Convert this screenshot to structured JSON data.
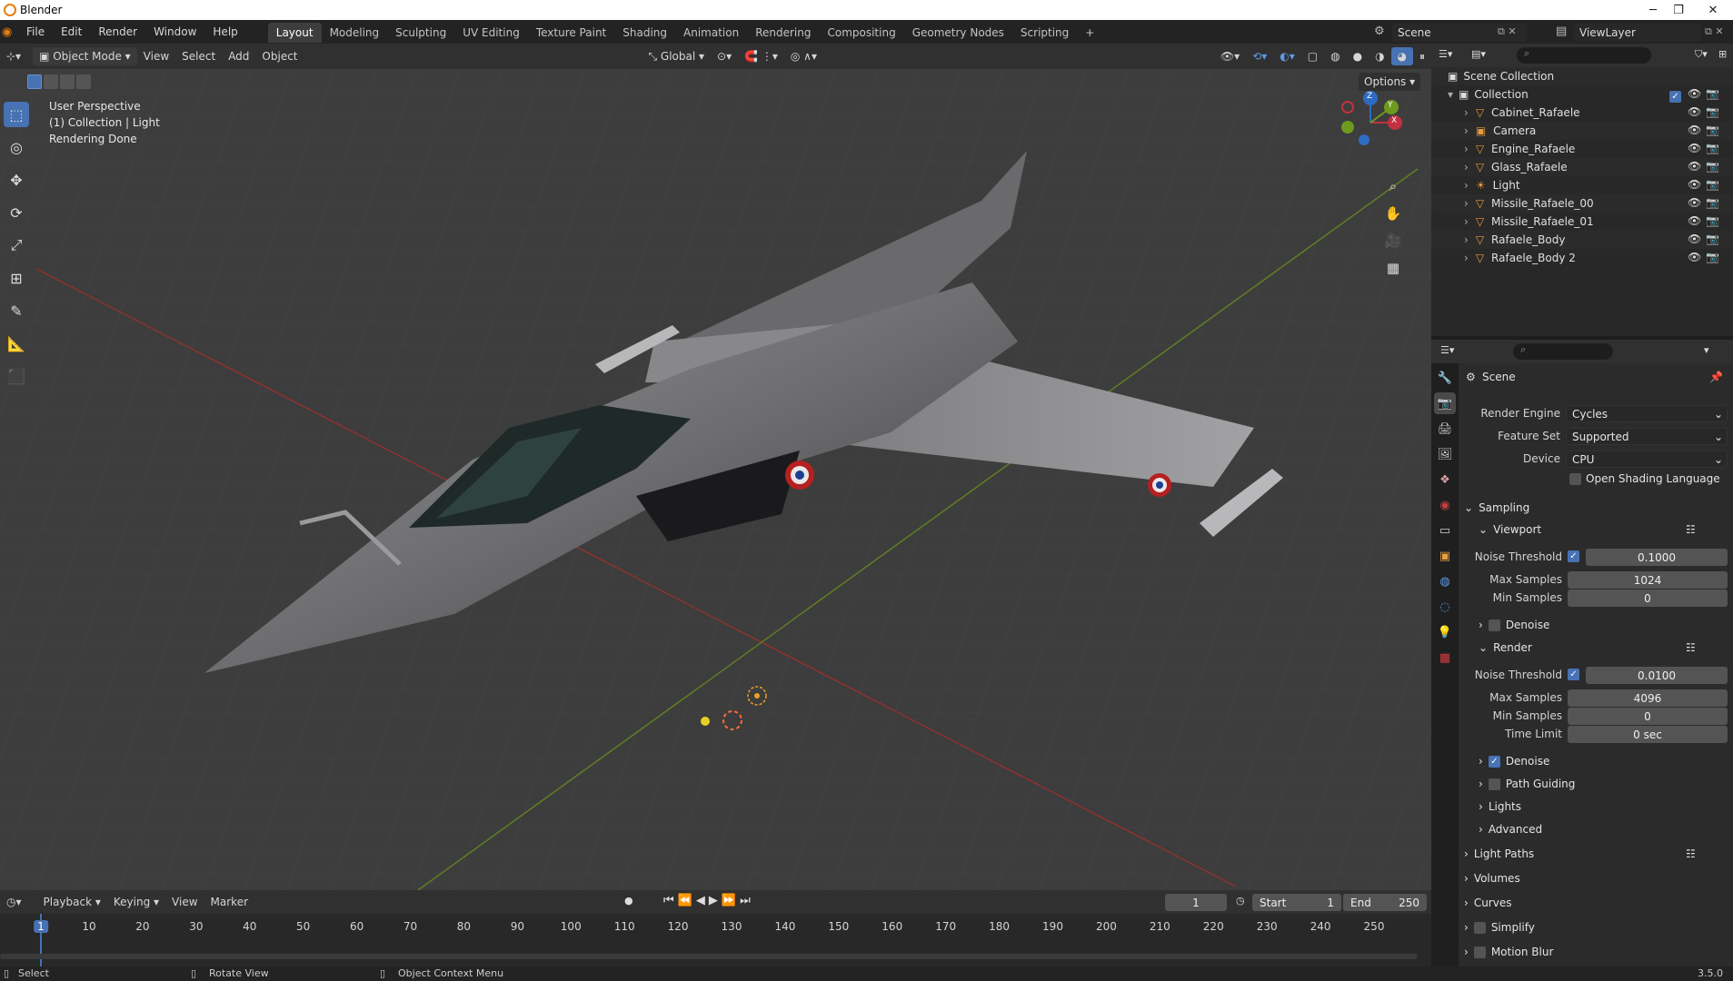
{
  "app": {
    "title": "Blender",
    "minimize": "─",
    "maximize": "❐",
    "close": "✕"
  },
  "menus": [
    "File",
    "Edit",
    "Render",
    "Window",
    "Help"
  ],
  "workspaces": [
    "Layout",
    "Modeling",
    "Sculpting",
    "UV Editing",
    "Texture Paint",
    "Shading",
    "Animation",
    "Rendering",
    "Compositing",
    "Geometry Nodes",
    "Scripting",
    "+"
  ],
  "scene": "Scene",
  "viewlayer": "ViewLayer",
  "viewport": {
    "mode": "Object Mode",
    "menus": [
      "View",
      "Select",
      "Add",
      "Object"
    ],
    "orientation": "Global",
    "options": "Options",
    "info": [
      "User Perspective",
      "(1) Collection | Light",
      "Rendering Done"
    ],
    "gizmo": {
      "x": "X",
      "y": "Y",
      "z": "Z"
    }
  },
  "outliner": {
    "root": "Scene Collection",
    "collection": "Collection",
    "items": [
      {
        "name": "Cabinet_Rafaele",
        "type": "mesh"
      },
      {
        "name": "Camera",
        "type": "camera"
      },
      {
        "name": "Engine_Rafaele",
        "type": "mesh"
      },
      {
        "name": "Glass_Rafaele",
        "type": "mesh"
      },
      {
        "name": "Light",
        "type": "light"
      },
      {
        "name": "Missile_Rafaele_00",
        "type": "mesh"
      },
      {
        "name": "Missile_Rafaele_01",
        "type": "mesh"
      },
      {
        "name": "Rafaele_Body",
        "type": "mesh"
      },
      {
        "name": "Rafaele_Body 2",
        "type": "mesh"
      }
    ]
  },
  "properties": {
    "context": "Scene",
    "render_engine_label": "Render Engine",
    "render_engine": "Cycles",
    "feature_set_label": "Feature Set",
    "feature_set": "Supported",
    "device_label": "Device",
    "device": "CPU",
    "osl_label": "Open Shading Language",
    "sampling": "Sampling",
    "viewport_panel": "Viewport",
    "noise_threshold_label": "Noise Threshold",
    "max_samples_label": "Max Samples",
    "min_samples_label": "Min Samples",
    "vp_noise": "0.1000",
    "vp_max": "1024",
    "vp_min": "0",
    "denoise_label": "Denoise",
    "render_panel": "Render",
    "r_noise": "0.0100",
    "r_max": "4096",
    "r_min": "0",
    "time_limit_label": "Time Limit",
    "r_time": "0 sec",
    "path_guiding": "Path Guiding",
    "lights": "Lights",
    "advanced": "Advanced",
    "light_paths": "Light Paths",
    "volumes": "Volumes",
    "curves": "Curves",
    "simplify": "Simplify",
    "motion_blur": "Motion Blur"
  },
  "timeline": {
    "menus": [
      "Playback",
      "Keying",
      "View",
      "Marker"
    ],
    "current_frame": "1",
    "start_label": "Start",
    "start": "1",
    "end_label": "End",
    "end": "250",
    "ticks": [
      "1",
      "10",
      "20",
      "30",
      "40",
      "50",
      "60",
      "70",
      "80",
      "90",
      "100",
      "110",
      "120",
      "130",
      "140",
      "150",
      "160",
      "170",
      "180",
      "190",
      "200",
      "210",
      "220",
      "230",
      "240",
      "250"
    ]
  },
  "status": {
    "select": "Select",
    "rotate": "Rotate View",
    "context_menu": "Object Context Menu",
    "version": "3.5.0"
  },
  "colors": {
    "accent": "#4772b3",
    "orange": "#e87d0d",
    "x_axis": "#c1313f",
    "y_axis": "#6d9a1f",
    "mesh_icon": "#e89b3c"
  }
}
